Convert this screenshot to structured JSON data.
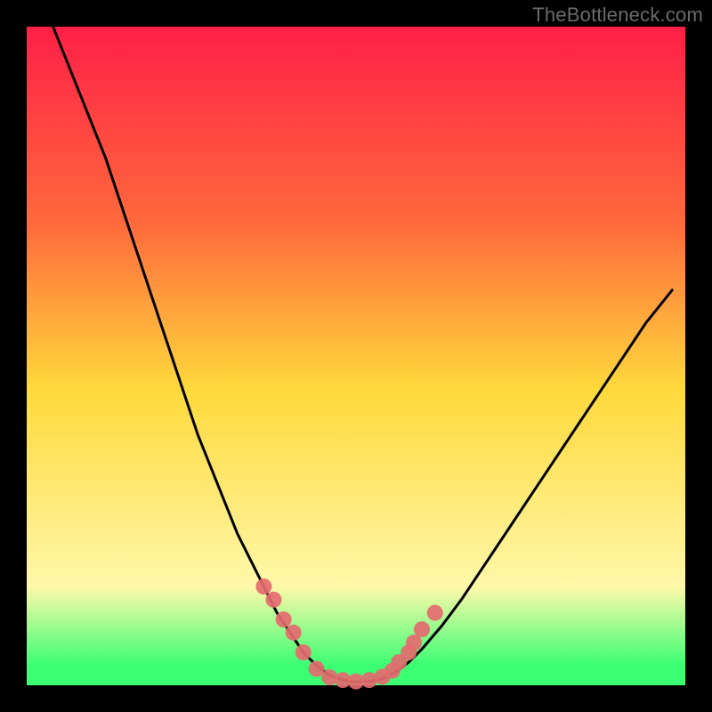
{
  "watermark": "TheBottleneck.com",
  "colors": {
    "frame": "#000000",
    "gradient_top": "#ff1f47",
    "gradient_upper": "#ff6a3c",
    "gradient_mid": "#ffd93b",
    "gradient_lower": "#fff8a9",
    "gradient_bottom": "#3bff73",
    "curve": "#000000",
    "dots": "#e46a6f",
    "watermark": "#6a6a6a"
  },
  "chart_data": {
    "type": "line",
    "title": "",
    "xlabel": "",
    "ylabel": "",
    "xlim": [
      0,
      100
    ],
    "ylim": [
      0,
      100
    ],
    "series": [
      {
        "name": "bottleneck-curve",
        "x": [
          4,
          6,
          8,
          10,
          12,
          14,
          16,
          18,
          20,
          22,
          24,
          26,
          28,
          30,
          32,
          34,
          36,
          38,
          40,
          42,
          44,
          46,
          48,
          50,
          52,
          54,
          56,
          58,
          60,
          63,
          66,
          70,
          74,
          78,
          82,
          86,
          90,
          94,
          98
        ],
        "y": [
          100,
          95,
          90,
          85,
          80,
          74,
          68,
          62,
          56,
          50,
          44,
          38,
          33,
          28,
          23,
          19,
          15,
          11,
          8,
          5,
          3,
          1.5,
          0.8,
          0.5,
          0.6,
          1.0,
          2.0,
          3.5,
          5.5,
          9,
          13,
          19,
          25,
          31,
          37,
          43,
          49,
          55,
          60
        ]
      }
    ],
    "highlight_points": {
      "name": "sweet-spot-dots",
      "x": [
        36,
        37.5,
        39,
        40.5,
        42,
        44,
        46,
        48,
        50,
        52,
        54,
        55.5,
        56.5,
        58,
        58.8,
        60,
        62
      ],
      "y": [
        15,
        13,
        10,
        8,
        5,
        2.5,
        1.2,
        0.8,
        0.6,
        0.8,
        1.3,
        2.2,
        3.5,
        5,
        6.5,
        8.5,
        11
      ]
    },
    "gradient_bands": [
      {
        "y": 100,
        "color": "#ff1f47"
      },
      {
        "y": 70,
        "color": "#ff6a3c"
      },
      {
        "y": 45,
        "color": "#ffd93b"
      },
      {
        "y": 15,
        "color": "#fff8a9"
      },
      {
        "y": 3,
        "color": "#3bff73"
      }
    ]
  }
}
